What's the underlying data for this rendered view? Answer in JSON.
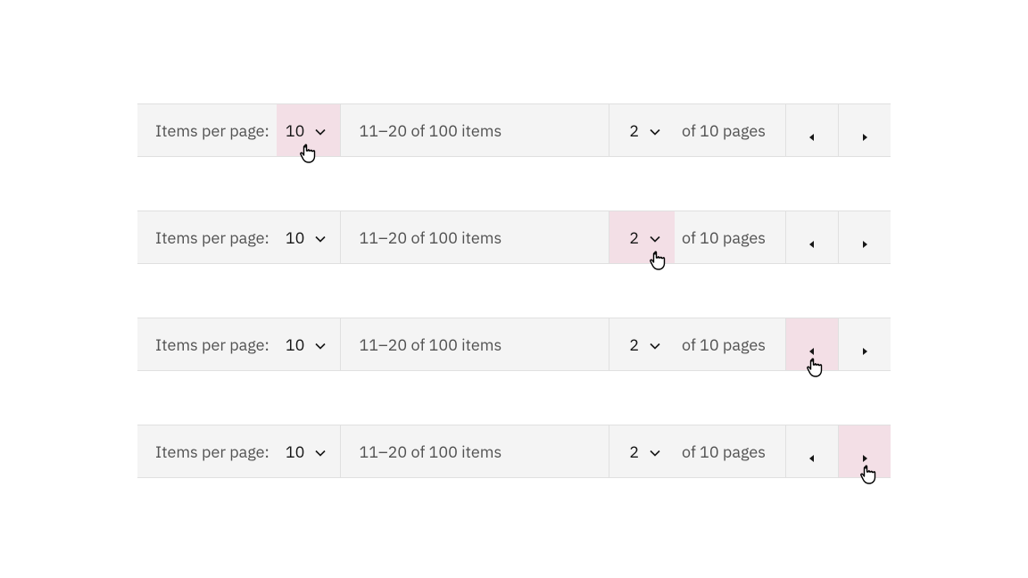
{
  "rows": [
    {
      "items_per_page_label": "Items per page:",
      "items_per_page_value": "10",
      "range_text": "11–20 of 100 items",
      "page_value": "2",
      "page_suffix": "of 10 pages",
      "highlight": "ipp"
    },
    {
      "items_per_page_label": "Items per page:",
      "items_per_page_value": "10",
      "range_text": "11–20 of 100 items",
      "page_value": "2",
      "page_suffix": "of 10 pages",
      "highlight": "page"
    },
    {
      "items_per_page_label": "Items per page:",
      "items_per_page_value": "10",
      "range_text": "11–20 of 100 items",
      "page_value": "2",
      "page_suffix": "of 10 pages",
      "highlight": "prev"
    },
    {
      "items_per_page_label": "Items per page:",
      "items_per_page_value": "10",
      "range_text": "11–20 of 100 items",
      "page_value": "2",
      "page_suffix": "of 10 pages",
      "highlight": "next"
    }
  ],
  "colors": {
    "highlight": "#f3dfe6",
    "border": "#e0e0e0",
    "bg": "#f4f4f4",
    "text_primary": "#161616",
    "text_secondary": "#525252"
  }
}
